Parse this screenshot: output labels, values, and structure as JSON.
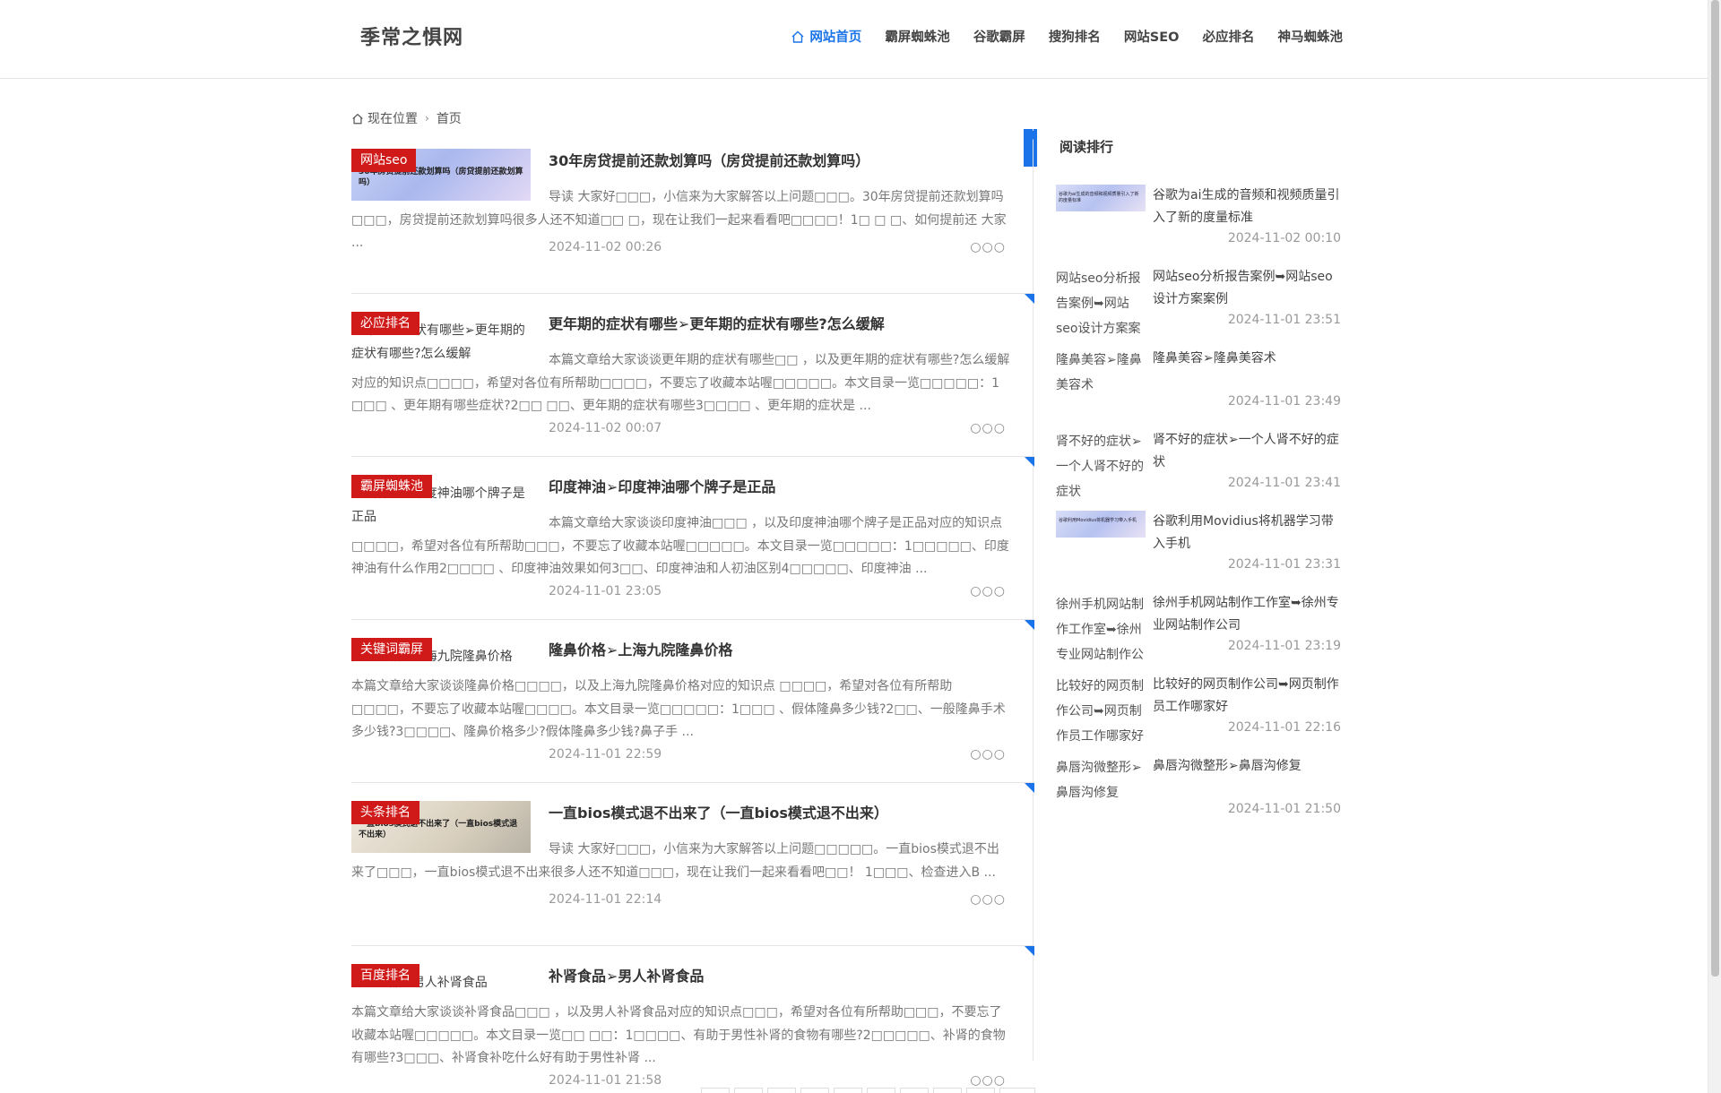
{
  "header": {
    "logo": "季常之惧网",
    "nav": [
      "网站首页",
      "霸屏蜘蛛池",
      "谷歌霸屏",
      "搜狗排名",
      "网站SEO",
      "必应排名",
      "神马蜘蛛池"
    ]
  },
  "breadcrumb": {
    "current_label": "现在位置",
    "home": "首页"
  },
  "posts": [
    {
      "category": "网站seo",
      "thumb_text": "30年房贷提前还款划算吗（房贷提前还款划算吗）",
      "title": "30年房贷提前还款划算吗（房贷提前还款划算吗）",
      "excerpt": "导读 大家好□□□，小信来为大家解答以上问题□□□。30年房贷提前还款划算吗□□□，房贷提前还款划算吗很多人还不知道□□ □，现在让我们一起来看看吧□□□□！1□ □ □、如何提前还 大家 ...",
      "date": "2024-11-02 00:26"
    },
    {
      "category": "必应排名",
      "thumb_alt": "更年期的症状有哪些➢更年期的症状有哪些?怎么缓解",
      "title": "更年期的症状有哪些➢更年期的症状有哪些?怎么缓解",
      "excerpt": "本篇文章给大家谈谈更年期的症状有哪些□□ ，以及更年期的症状有哪些?怎么缓解对应的知识点□□□□，希望对各位有所帮助□□□□，不要忘了收藏本站喔□□□□□。本文目录一览□□□□□：1 □□□ 、更年期有哪些症状?2□□ □□、更年期的症状有哪些3□□□□ 、更年期的症状是 ...",
      "date": "2024-11-02 00:07"
    },
    {
      "category": "霸屏蜘蛛池",
      "thumb_alt": "印度神油➢印度神油哪个牌子是正品",
      "title": "印度神油➢印度神油哪个牌子是正品",
      "excerpt": "本篇文章给大家谈谈印度神油□□□ ，以及印度神油哪个牌子是正品对应的知识点□□□□，希望对各位有所帮助□□□，不要忘了收藏本站喔□□□□□。本文目录一览□□□□□：1□□□□□、印度神油有什么作用2□□□□ 、印度神油效果如何3□□、印度神油和人初油区别4□□□□□、印度神油 ...",
      "date": "2024-11-01 23:05"
    },
    {
      "category": "关键词霸屏",
      "thumb_alt": "隆鼻价格➢上海九院隆鼻价格",
      "title": "隆鼻价格➢上海九院隆鼻价格",
      "excerpt": "本篇文章给大家谈谈隆鼻价格□□□□，以及上海九院隆鼻价格对应的知识点 □□□□，希望对各位有所帮助□□□□，不要忘了收藏本站喔□□□□。本文目录一览□□□□□：1□□□ 、假体隆鼻多少钱?2□□、一般隆鼻手术多少钱?3□□□□、隆鼻价格多少?假体隆鼻多少钱?鼻子手 ...",
      "date": "2024-11-01 22:59"
    },
    {
      "category": "头条排名",
      "thumb_text": "一直bios模式退不出来了（一直bios模式退不出来）",
      "title": "一直bios模式退不出来了（一直bios模式退不出来）",
      "excerpt": "导读 大家好□□□，小信来为大家解答以上问题□□□□□。一直bios模式退不出来了□□□，一直bios模式退不出来很多人还不知道□□□，现在让我们一起来看看吧□□！ 1□□□、检查进入B ...",
      "date": "2024-11-01 22:14"
    },
    {
      "category": "百度排名",
      "thumb_alt": "补肾食品➢男人补肾食品",
      "title": "补肾食品➢男人补肾食品",
      "excerpt": "本篇文章给大家谈谈补肾食品□□□ ，以及男人补肾食品对应的知识点□□□，希望对各位有所帮助□□□，不要忘了收藏本站喔□□□□□。本文目录一览□□ □□：1□□□□、有助于男性补肾的食物有哪些?2□□□□□、补肾的食物有哪些?3□□□、补肾食补吃什么好有助于男性补肾 ...",
      "date": "2024-11-01 21:58"
    }
  ],
  "more_label": "○○○",
  "sidebar": {
    "title": "阅读排行",
    "items": [
      {
        "thumb_text": "谷歌为ai生成的音频和视频质量引入了新的度量标准",
        "title": "谷歌为ai生成的音频和视频质量引入了新的度量标准",
        "date": "2024-11-02 00:10"
      },
      {
        "thumb_alt": "网站seo分析报告案例➥网站seo设计方案案例",
        "title": "网站seo分析报告案例➥网站seo设计方案案例",
        "date": "2024-11-01 23:51"
      },
      {
        "thumb_alt": "隆鼻美容➢隆鼻美容术",
        "title": "隆鼻美容➢隆鼻美容术",
        "date": "2024-11-01 23:49"
      },
      {
        "thumb_alt": "肾不好的症状➢一个人肾不好的症状",
        "title": "肾不好的症状➢一个人肾不好的症状",
        "date": "2024-11-01 23:41"
      },
      {
        "thumb_text": "谷歌利用Movidius将机器学习带入手机",
        "title": "谷歌利用Movidius将机器学习带入手机",
        "date": "2024-11-01 23:31"
      },
      {
        "thumb_alt": "徐州手机网站制作工作室➥徐州专业网站制作公司",
        "title": "徐州手机网站制作工作室➥徐州专业网站制作公司",
        "date": "2024-11-01 23:19"
      },
      {
        "thumb_alt": "比较好的网页制作公司➥网页制作员工作哪家好",
        "title": "比较好的网页制作公司➥网页制作员工作哪家好",
        "date": "2024-11-01 22:16"
      },
      {
        "thumb_alt": "鼻唇沟微整形➢鼻唇沟修复",
        "title": "鼻唇沟微整形➢鼻唇沟修复",
        "date": "2024-11-01 21:50"
      }
    ]
  },
  "colors": {
    "accent": "#1a73e8",
    "category_bg": "#d01a1a"
  }
}
